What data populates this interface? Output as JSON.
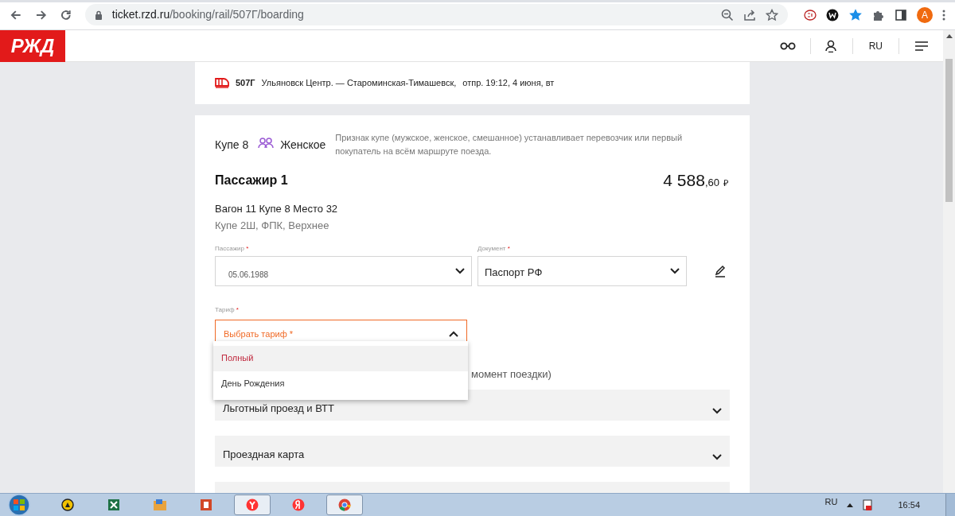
{
  "browser": {
    "url_host": "ticket.rzd.ru",
    "url_path": "/booking/rail/507Г/boarding",
    "profile_initial": "A"
  },
  "site_header": {
    "logo": "РЖД",
    "language": "RU"
  },
  "title_card": {
    "train_number": "507Г",
    "route": "Ульяновск Центр. — Староминская-Тимашевск,",
    "departure": "отпр. 19:12, 4 июня, вт"
  },
  "compartment": {
    "name": "Купе 8",
    "gender": "Женское",
    "note": "Признак купе (мужское, женское, смешанное) устанавливает перевозчик или первый покупатель на всём маршруте поезда."
  },
  "passenger": {
    "title": "Пассажир 1",
    "price_whole": "4 588",
    "price_fraction": ",60",
    "currency": "₽",
    "seat": "Вагон 11 Купе 8 Место 32",
    "car_info": "Купе 2Ш, ФПК, Верхнее"
  },
  "fields": [
    {
      "label": "Пассажир",
      "required": "*",
      "value": "05.06.1988"
    },
    {
      "label": "Документ",
      "required": "*",
      "value": "Паспорт РФ"
    }
  ],
  "tariff": {
    "label": "Тариф",
    "required": "*",
    "placeholder": "Выбрать тариф *",
    "expanded": true,
    "options": [
      {
        "label": "Полный",
        "selected": true
      },
      {
        "label": "День Рождения",
        "selected": false
      }
    ]
  },
  "hidden_note": "момент поездки)",
  "accordions": [
    {
      "label": "Льготный проезд и ВТТ",
      "expanded": false
    },
    {
      "label": "Проездная карта",
      "expanded": false
    }
  ],
  "taskbar": {
    "language": "RU",
    "time": "16:54",
    "apps": [
      {
        "kind": "circle",
        "color": "#f2c200",
        "selected": false
      },
      {
        "kind": "excel",
        "color": "#1e7145",
        "selected": false
      },
      {
        "kind": "folder",
        "color": "#e8a33d",
        "selected": false
      },
      {
        "kind": "ppt",
        "color": "#d24726",
        "selected": false
      },
      {
        "kind": "yabrowser",
        "color": "#ff3333",
        "selected": true
      },
      {
        "kind": "yandex",
        "color": "#ff3333",
        "selected": false
      },
      {
        "kind": "chrome",
        "color": "#db4437",
        "selected": true
      }
    ]
  }
}
